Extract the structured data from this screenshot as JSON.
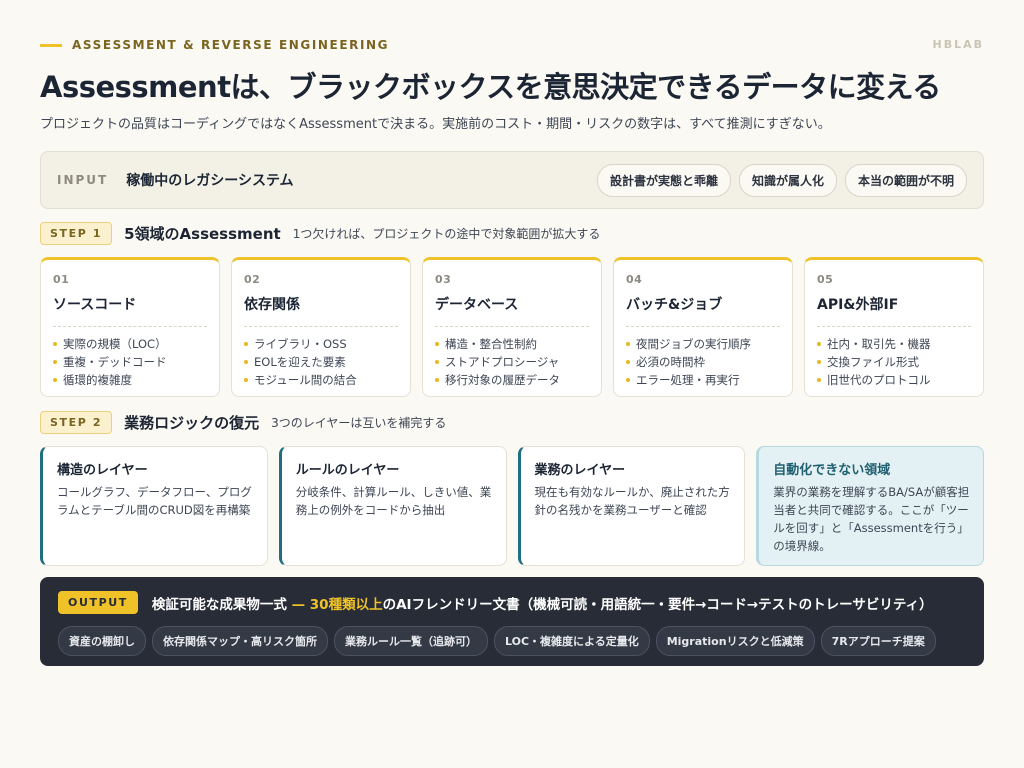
{
  "header": {
    "eyebrow": "ASSESSMENT & REVERSE ENGINEERING",
    "brand": "HBLAB",
    "title": "Assessmentは、ブラックボックスを意思決定できるデータに変える",
    "subtitle": "プロジェクトの品質はコーディングではなくAssessmentで決まる。実施前のコスト・期間・リスクの数字は、すべて推測にすぎない。"
  },
  "input": {
    "label": "INPUT",
    "text": "稼働中のレガシーシステム",
    "tags": [
      "設計書が実態と乖離",
      "知識が属人化",
      "本当の範囲が不明"
    ]
  },
  "step1": {
    "badge": "STEP 1",
    "title": "5領域のAssessment",
    "desc": "1つ欠ければ、プロジェクトの途中で対象範囲が拡大する",
    "cards": [
      {
        "num": "01",
        "title": "ソースコード",
        "items": [
          "実際の規模（LOC）",
          "重複・デッドコード",
          "循環的複雑度"
        ]
      },
      {
        "num": "02",
        "title": "依存関係",
        "items": [
          "ライブラリ・OSS",
          "EOLを迎えた要素",
          "モジュール間の結合"
        ]
      },
      {
        "num": "03",
        "title": "データベース",
        "items": [
          "構造・整合性制約",
          "ストアドプロシージャ",
          "移行対象の履歴データ"
        ]
      },
      {
        "num": "04",
        "title": "バッチ&ジョブ",
        "items": [
          "夜間ジョブの実行順序",
          "必須の時間枠",
          "エラー処理・再実行"
        ]
      },
      {
        "num": "05",
        "title": "API&外部IF",
        "items": [
          "社内・取引先・機器",
          "交換ファイル形式",
          "旧世代のプロトコル"
        ]
      }
    ]
  },
  "step2": {
    "badge": "STEP 2",
    "title": "業務ロジックの復元",
    "desc": "3つのレイヤーは互いを補完する",
    "cards": [
      {
        "title": "構造のレイヤー",
        "desc": "コールグラフ、データフロー、プログラムとテーブル間のCRUD図を再構築"
      },
      {
        "title": "ルールのレイヤー",
        "desc": "分岐条件、計算ルール、しきい値、業務上の例外をコードから抽出"
      },
      {
        "title": "業務のレイヤー",
        "desc": "現在も有効なルールか、廃止された方針の名残かを業務ユーザーと確認"
      },
      {
        "title": "自動化できない領域",
        "desc": "業界の業務を理解するBA/SAが顧客担当者と共同で確認する。ここが「ツールを回す」と「Assessmentを行う」の境界線。"
      }
    ]
  },
  "output": {
    "badge": "OUTPUT",
    "text_before": "検証可能な成果物一式 ",
    "text_highlight": "— 30種類以上",
    "text_after": "のAIフレンドリー文書（機械可読・用語統一・要件→コード→テストのトレーサビリティ）",
    "tags": [
      "資産の棚卸し",
      "依存関係マップ・高リスク箇所",
      "業務ルール一覧（追跡可）",
      "LOC・複雑度による定量化",
      "Migrationリスクと低減策",
      "7Rアプローチ提案"
    ]
  },
  "colors": {
    "accent": "#f0c229",
    "teal": "#1f6f80",
    "dark": "#272c36",
    "background": "#fbf9f3"
  }
}
